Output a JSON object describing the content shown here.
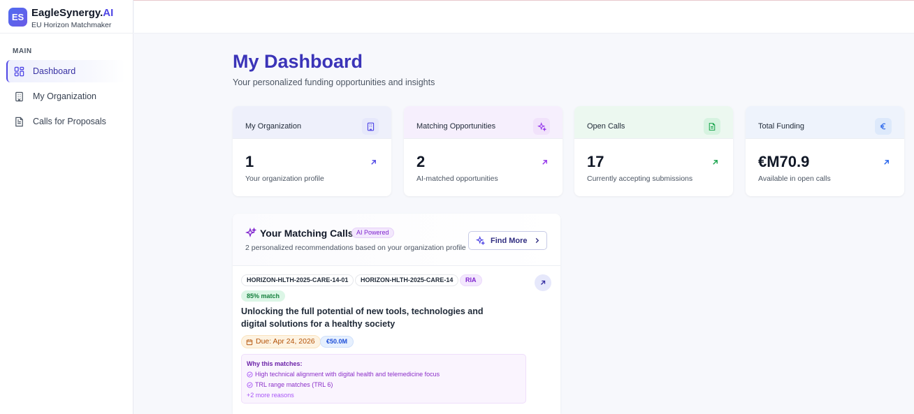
{
  "brand": {
    "logo_text": "ES",
    "name_main": "EagleSynergy.",
    "name_ai": "AI",
    "subtitle": "EU Horizon Matchmaker"
  },
  "sidebar": {
    "section_label": "MAIN",
    "items": [
      {
        "label": "Dashboard",
        "icon": "grid-icon",
        "active": true
      },
      {
        "label": "My Organization",
        "icon": "building-icon",
        "active": false
      },
      {
        "label": "Calls for Proposals",
        "icon": "document-icon",
        "active": false
      }
    ]
  },
  "main": {
    "title": "My Dashboard",
    "subtitle": "Your personalized funding opportunities and insights"
  },
  "stats": [
    {
      "label": "My Organization",
      "value": "1",
      "desc": "Your organization profile",
      "icon": "building-icon",
      "icon_bg": "#e6e8fb",
      "icon_color": "#4f46e5",
      "head_bg": "#eef0fb"
    },
    {
      "label": "Matching Opportunities",
      "value": "2",
      "desc": "AI-matched opportunities",
      "icon": "sparkles-icon",
      "icon_bg": "#f1e2fb",
      "icon_color": "#9333ea",
      "head_bg": "#f6effd"
    },
    {
      "label": "Open Calls",
      "value": "17",
      "desc": "Currently accepting submissions",
      "icon": "document-icon",
      "icon_bg": "#d6f3e0",
      "icon_color": "#16a34a",
      "head_bg": "#ecf8f0"
    },
    {
      "label": "Total Funding",
      "value": "€M70.9",
      "desc": "Available in open calls",
      "icon": "euro-icon",
      "icon_bg": "#dde9fb",
      "icon_color": "#2563eb",
      "head_bg": "#eef3fc"
    }
  ],
  "matching": {
    "title": "Your Matching Calls",
    "badge": "AI Powered",
    "subtitle": "2 personalized recommendations based on your organization profile",
    "find_more_label": "Find More",
    "calls": [
      {
        "tags": [
          "HORIZON-HLTH-2025-CARE-14-01",
          "HORIZON-HLTH-2025-CARE-14",
          "RIA"
        ],
        "match": "85% match",
        "title": "Unlocking the full potential of new tools, technologies and digital solutions for a healthy society",
        "due": "Due: Apr 24, 2026",
        "amount": "€50.0M",
        "why_title": "Why this matches:",
        "reasons": [
          "High technical alignment with digital health and telemedicine focus",
          "TRL range matches (TRL 6)"
        ],
        "more": "+2 more reasons"
      }
    ]
  },
  "colors": {
    "accent": "#4f46e5",
    "title": "#3b34b8",
    "purple": "#9333ea",
    "green": "#16a34a",
    "blue": "#2563eb"
  }
}
